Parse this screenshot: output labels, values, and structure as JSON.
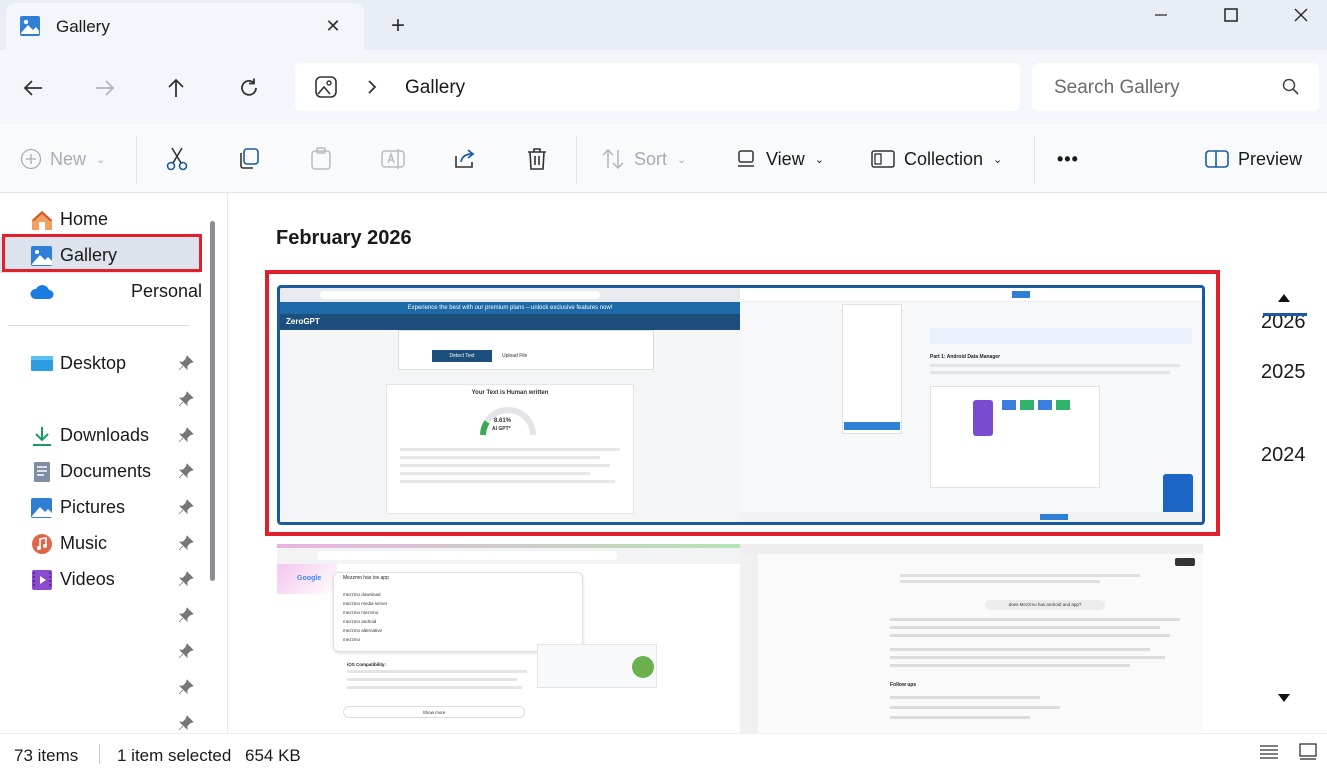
{
  "window": {
    "tab_title": "Gallery",
    "new_tab_label": "+"
  },
  "nav": {
    "address_segment": "Gallery",
    "search_placeholder": "Search Gallery"
  },
  "command_bar": {
    "new_label": "New",
    "sort_label": "Sort",
    "view_label": "View",
    "collection_label": "Collection",
    "more_label": "•••",
    "preview_label": "Preview"
  },
  "sidebar": {
    "items": [
      {
        "label": "Home",
        "icon": "home-icon"
      },
      {
        "label": "Gallery",
        "icon": "gallery-icon",
        "selected": true
      },
      {
        "label": "Personal",
        "icon": "onedrive-cloud-icon"
      },
      {
        "label": "Desktop",
        "icon": "desktop-icon",
        "pinned": true
      },
      {
        "label": "Downloads",
        "icon": "downloads-icon",
        "pinned": true
      },
      {
        "label": "Documents",
        "icon": "documents-icon",
        "pinned": true
      },
      {
        "label": "Pictures",
        "icon": "pictures-icon",
        "pinned": true
      },
      {
        "label": "Music",
        "icon": "music-icon",
        "pinned": true
      },
      {
        "label": "Videos",
        "icon": "videos-icon",
        "pinned": true
      }
    ]
  },
  "gallery": {
    "month_heading": "February 2026",
    "years": [
      "2026",
      "2025",
      "2024"
    ],
    "thumbnails": [
      {
        "title": "ZeroGPT",
        "banner": "Experience the best with our premium plans – unlock exclusive features now!",
        "result_title": "Your Text is Human written",
        "result_value": "8.61%",
        "result_sub": "AI GPT*",
        "button": "Detect Text",
        "upload": "Upload File"
      },
      {
        "title": "Part 1: Android Data Manager"
      },
      {
        "search_query": "Mezzmo has ios app",
        "suggestions": [
          "mezzmo download",
          "mezzmo media server",
          "mezzmo mezzmo",
          "mezzmo android",
          "mezzmo alternative",
          "mezzmo"
        ],
        "heading": "iOS Compatibility:",
        "show_more": "Show more"
      },
      {
        "question": "does Mezzmo has android and app?",
        "section": "Follow ups"
      }
    ]
  },
  "status": {
    "item_count": "73 items",
    "selected": "1 item selected",
    "size": "654 KB"
  },
  "colors": {
    "accent": "#1b5aa0",
    "highlight": "#e0202a",
    "chrome": "#e9eef6"
  }
}
